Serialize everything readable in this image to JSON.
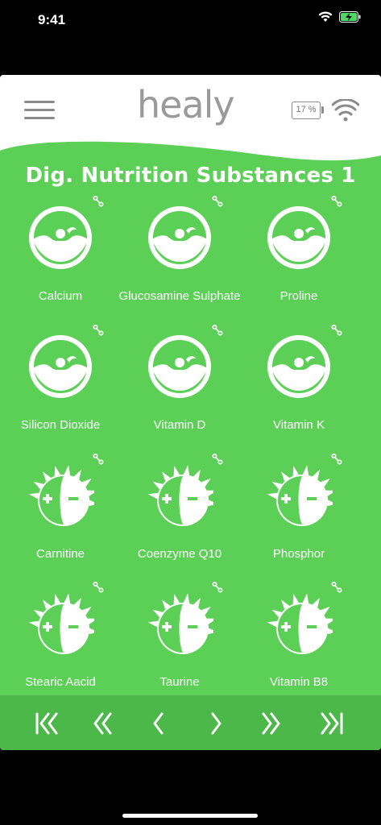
{
  "status": {
    "time": "9:41"
  },
  "header": {
    "logo": "healy",
    "battery": "17 %"
  },
  "page_title": "Dig. Nutrition Substances 1",
  "items": [
    {
      "label": "Calcium",
      "icon": "face-icon"
    },
    {
      "label": "Glucosamine Sulphate",
      "icon": "face-icon"
    },
    {
      "label": "Proline",
      "icon": "face-icon"
    },
    {
      "label": "Silicon Dioxide",
      "icon": "face-icon"
    },
    {
      "label": "Vitamin D",
      "icon": "face-icon"
    },
    {
      "label": "Vitamin K",
      "icon": "face-icon"
    },
    {
      "label": "Carnitine",
      "icon": "plus-minus-icon"
    },
    {
      "label": "Coenzyme Q10",
      "icon": "plus-minus-icon"
    },
    {
      "label": "Phosphor",
      "icon": "plus-minus-icon"
    },
    {
      "label": "Stearic Aacid",
      "icon": "plus-minus-icon"
    },
    {
      "label": "Taurine",
      "icon": "plus-minus-icon"
    },
    {
      "label": "Vitamin B8",
      "icon": "plus-minus-icon"
    }
  ],
  "nav": [
    "first-page-icon",
    "rewind-icon",
    "previous-icon",
    "next-icon",
    "fast-forward-icon",
    "last-page-icon"
  ],
  "colors": {
    "green": "#5bcf56",
    "nav_green": "#4db84a",
    "header": "#ffffff",
    "gray": "#8a8a8a"
  }
}
